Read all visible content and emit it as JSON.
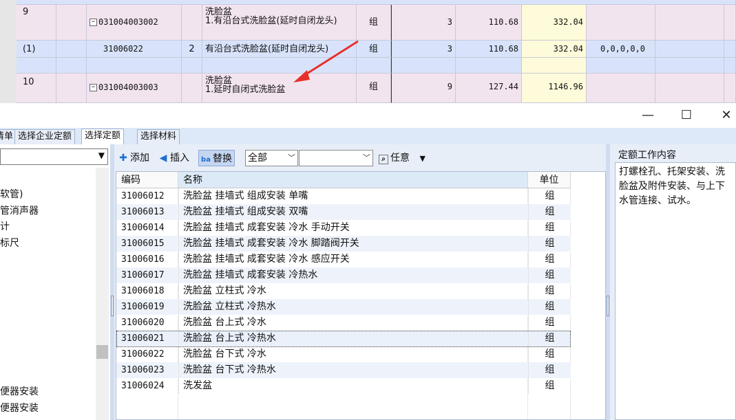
{
  "background_grid": {
    "rows": [
      {
        "seq": "9",
        "code": "031004003002",
        "qty_col": "",
        "name_line1": "洗脸盆",
        "name_line2": "1.有沿台式洗脸盆(延时自闭龙头)",
        "unit": "组",
        "qty": "3",
        "price": "110.68",
        "total": "332.04",
        "extra": ""
      },
      {
        "seq": "(1)",
        "code": "31006022",
        "qty_col": "2",
        "name_line1": "有沿台式洗脸盆(延时自闭龙头)",
        "name_line2": "",
        "unit": "组",
        "qty": "3",
        "price": "110.68",
        "total": "332.04",
        "extra": "0,0,0,0,0"
      },
      {
        "seq": "10",
        "code": "031004003003",
        "qty_col": "",
        "name_line1": "洗脸盆",
        "name_line2": "1.延时自闭式洗脸盆",
        "unit": "组",
        "qty": "9",
        "price": "127.44",
        "total": "1146.96",
        "extra": ""
      }
    ],
    "expander_symbol": "−"
  },
  "window": {
    "maximize_icon": "☐",
    "close_icon": "✕"
  },
  "tabs": [
    "清单",
    "选择企业定额",
    "选择定额",
    "选择材料"
  ],
  "left_panel": {
    "select_value": "",
    "items": [
      "软管)",
      "管消声器",
      "计",
      "标尺",
      "",
      "便器安装",
      "便器安装"
    ]
  },
  "toolbar": {
    "add_label": "添加",
    "insert_label": "插入",
    "replace_label": "替换",
    "scope_value": "全部",
    "filter_value": "",
    "any_label": "任意"
  },
  "quota_table": {
    "headers": {
      "code": "编码",
      "name": "名称",
      "unit": "单位"
    },
    "rows": [
      {
        "code": "31006012",
        "name": "洗脸盆 挂墙式 组成安装 单嘴",
        "unit": "组"
      },
      {
        "code": "31006013",
        "name": "洗脸盆 挂墙式 组成安装 双嘴",
        "unit": "组"
      },
      {
        "code": "31006014",
        "name": "洗脸盆 挂墙式 成套安装 冷水 手动开关",
        "unit": "组"
      },
      {
        "code": "31006015",
        "name": "洗脸盆 挂墙式 成套安装 冷水 脚踏阀开关",
        "unit": "组"
      },
      {
        "code": "31006016",
        "name": "洗脸盆 挂墙式 成套安装 冷水 感应开关",
        "unit": "组"
      },
      {
        "code": "31006017",
        "name": "洗脸盆 挂墙式 成套安装 冷热水",
        "unit": "组"
      },
      {
        "code": "31006018",
        "name": "洗脸盆 立柱式 冷水",
        "unit": "组"
      },
      {
        "code": "31006019",
        "name": "洗脸盆 立柱式 冷热水",
        "unit": "组"
      },
      {
        "code": "31006020",
        "name": "洗脸盆 台上式 冷水",
        "unit": "组"
      },
      {
        "code": "31006021",
        "name": "洗脸盆 台上式 冷热水",
        "unit": "组"
      },
      {
        "code": "31006022",
        "name": "洗脸盆 台下式 冷水",
        "unit": "组"
      },
      {
        "code": "31006023",
        "name": "洗脸盆 台下式 冷热水",
        "unit": "组"
      },
      {
        "code": "31006024",
        "name": "洗发盆",
        "unit": "组"
      }
    ],
    "selected_code": "31006021"
  },
  "right_panel": {
    "title": "定额工作内容",
    "content": "打螺栓孔、托架安装、洗脸盆及附件安装、与上下水管连接、试水。"
  },
  "colors": {
    "annotation_arrow": "#e8302a",
    "accent_blue": "#1f6fd1"
  }
}
